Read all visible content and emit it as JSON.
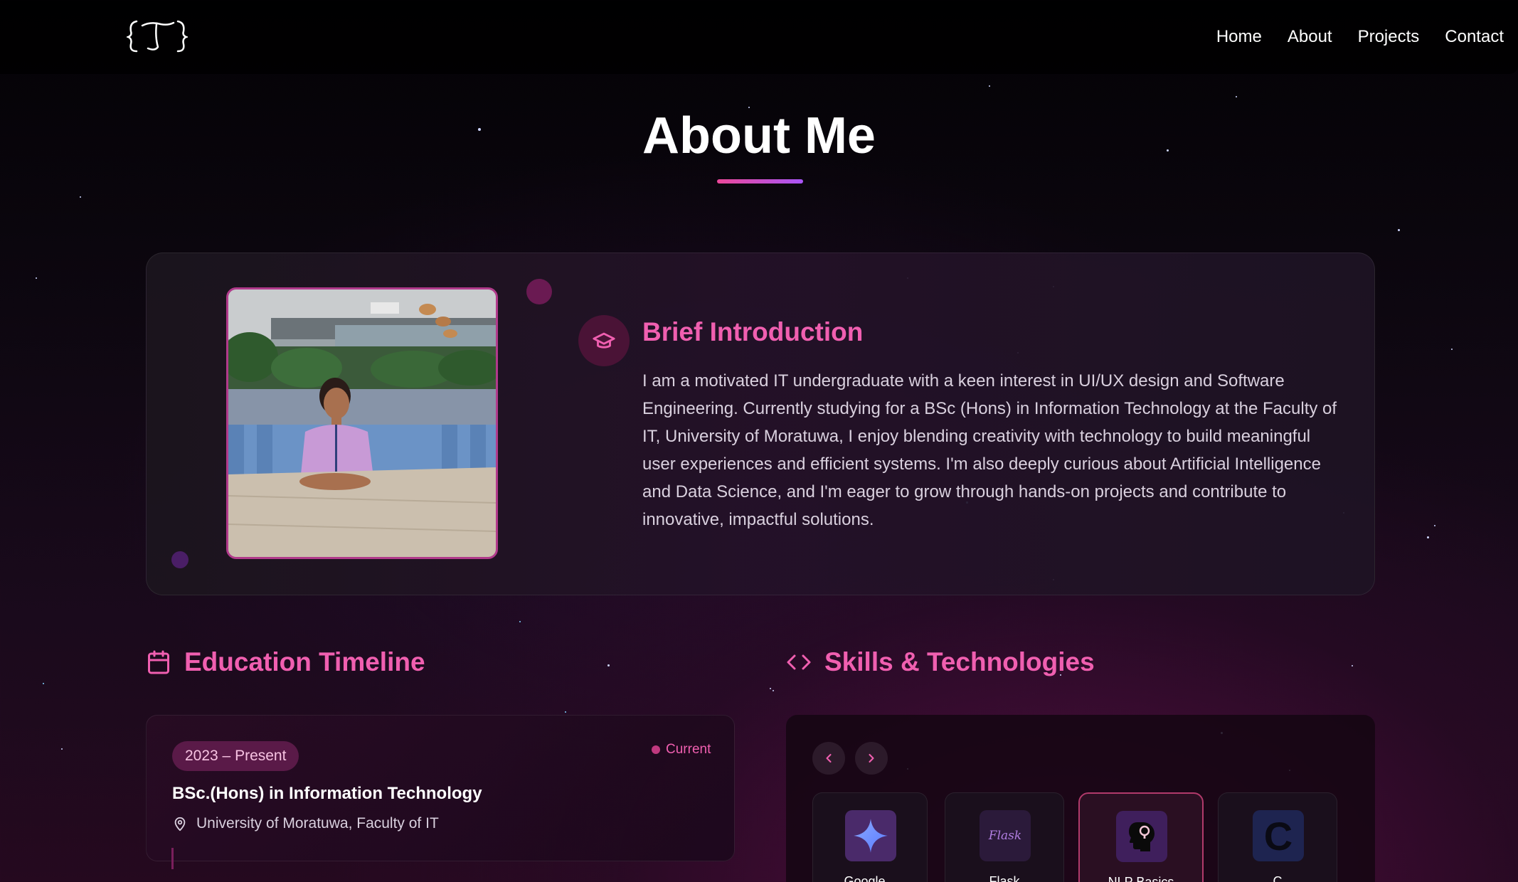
{
  "nav": {
    "logo_text": "{T}",
    "links": [
      {
        "label": "Home"
      },
      {
        "label": "About"
      },
      {
        "label": "Projects"
      },
      {
        "label": "Contact"
      }
    ]
  },
  "header": {
    "title": "About Me"
  },
  "intro": {
    "icon": "graduation-cap-icon",
    "heading": "Brief Introduction",
    "text": "I am a motivated IT undergraduate with a keen interest in UI/UX design and Software Engineering. Currently studying for a BSc (Hons) in Information Technology at the Faculty of IT, University of Moratuwa, I enjoy blending creativity with technology to build meaningful user experiences and efficient systems. I'm also deeply curious about Artificial Intelligence and Data Science, and I'm eager to grow through hands-on projects and contribute to innovative, impactful solutions."
  },
  "education": {
    "icon": "calendar-icon",
    "heading": "Education Timeline",
    "items": [
      {
        "period": "2023 – Present",
        "status": "Current",
        "degree": "BSc.(Hons) in Information Technology",
        "institution": "University of Moratuwa, Faculty of IT"
      }
    ]
  },
  "skills": {
    "icon": "code-brackets-icon",
    "heading": "Skills & Technologies",
    "prev_icon": "chevron-left-icon",
    "next_icon": "chevron-right-icon",
    "items": [
      {
        "label": "Google...",
        "icon": "gemini-sparkle-icon"
      },
      {
        "label": "Flask",
        "icon": "flask-logo-icon",
        "logo_text": "Flask"
      },
      {
        "label": "NLP Basics",
        "icon": "brain-head-icon"
      },
      {
        "label": "C",
        "icon": "c-language-icon",
        "logo_text": "C"
      }
    ]
  },
  "colors": {
    "accent_pink": "#f05fb0",
    "accent_purple": "#a855f7",
    "background": "#0d0710"
  }
}
